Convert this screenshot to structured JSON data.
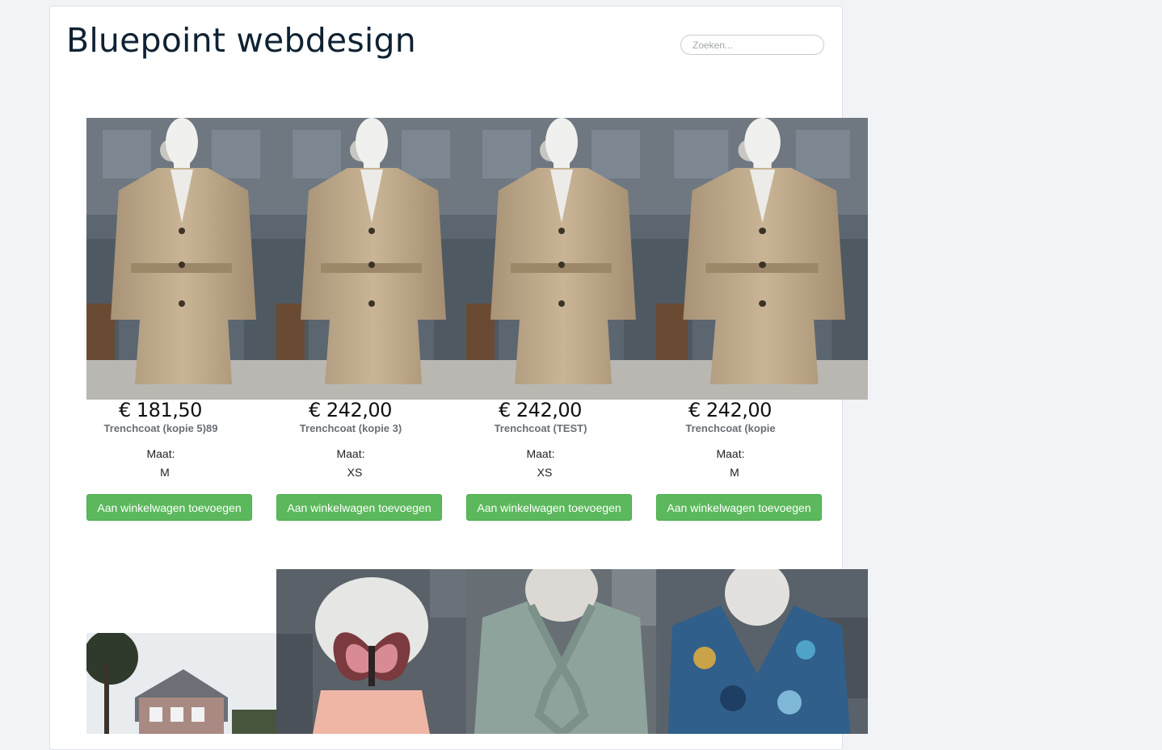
{
  "site": {
    "title": "Bluepoint webdesign",
    "search_placeholder": "Zoeken..."
  },
  "products": [
    {
      "price": "€ 181,50",
      "name": "Trenchcoat (kopie 5)89",
      "size_label": "Maat:",
      "size": "M",
      "button": "Aan winkelwagen toevoegen",
      "image_icon": "trenchcoat-image"
    },
    {
      "price": "€ 242,00",
      "name": "Trenchcoat (kopie 3)",
      "size_label": "Maat:",
      "size": "XS",
      "button": "Aan winkelwagen toevoegen",
      "image_icon": "trenchcoat-image"
    },
    {
      "price": "€ 242,00",
      "name": "Trenchcoat (TEST)",
      "size_label": "Maat:",
      "size": "XS",
      "button": "Aan winkelwagen toevoegen",
      "image_icon": "trenchcoat-image"
    },
    {
      "price": "€ 242,00",
      "name": "Trenchcoat (kopie",
      "size_label": "Maat:",
      "size": "M",
      "button": "Aan winkelwagen toevoegen",
      "image_icon": "trenchcoat-image"
    }
  ],
  "second_row_images": [
    "house-image",
    "butterfly-top-image",
    "green-ruffle-blouse-image",
    "blue-paisley-blouse-image"
  ],
  "colors": {
    "button": "#5cb85c",
    "title": "#0f2233",
    "background": "#f1f3f6"
  }
}
